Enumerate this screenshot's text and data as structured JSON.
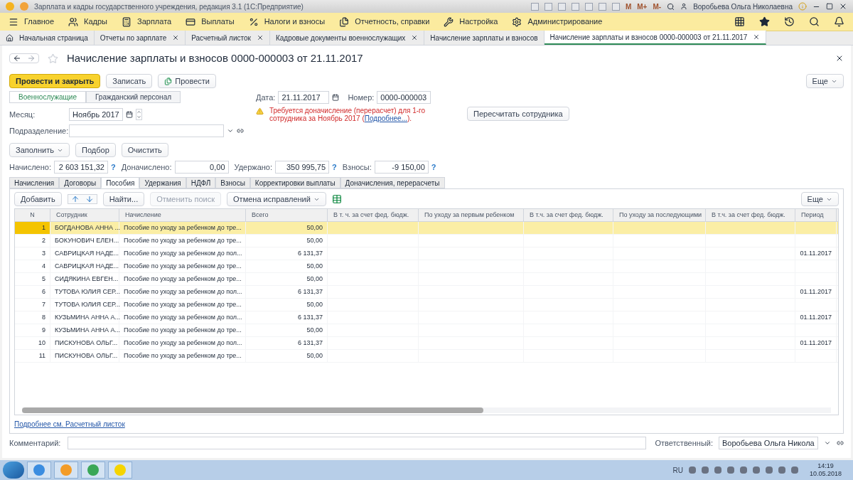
{
  "window": {
    "title": "Зарплата и кадры государственного учреждения, редакция 3.1  (1С:Предприятие)",
    "user": "Воробьева Ольга Николаевна",
    "memory_buttons": [
      "M",
      "M+",
      "M-"
    ]
  },
  "menu": [
    {
      "label": "Главное"
    },
    {
      "label": "Кадры"
    },
    {
      "label": "Зарплата"
    },
    {
      "label": "Выплаты"
    },
    {
      "label": "Налоги и взносы"
    },
    {
      "label": "Отчетность, справки"
    },
    {
      "label": "Настройка"
    },
    {
      "label": "Администрирование"
    }
  ],
  "open_tabs": [
    {
      "label": "Начальная страница",
      "home": true,
      "closable": false,
      "selected": false
    },
    {
      "label": "Отчеты по зарплате",
      "home": false,
      "closable": true,
      "selected": false
    },
    {
      "label": "Расчетный листок",
      "home": false,
      "closable": true,
      "selected": false
    },
    {
      "label": "Кадровые документы военнослужащих",
      "home": false,
      "closable": true,
      "selected": false
    },
    {
      "label": "Начисление зарплаты и взносов",
      "home": false,
      "closable": false,
      "selected": false
    },
    {
      "label": "Начисление зарплаты и взносов 0000-000003 от 21.11.2017",
      "home": false,
      "closable": true,
      "selected": true
    }
  ],
  "document": {
    "title": "Начисление зарплаты и взносов 0000-000003 от 21.11.2017",
    "buttons": [
      {
        "label": "Провести и закрыть",
        "kind": "primary"
      },
      {
        "label": "Записать",
        "kind": "plain"
      },
      {
        "label": "Провести",
        "kind": "icon"
      }
    ],
    "more": "Еще",
    "segments": [
      {
        "label": "Военнослужащие",
        "selected": true
      },
      {
        "label": "Гражданский персонал",
        "selected": false
      }
    ],
    "date_label": "Дата:",
    "date": "21.11.2017",
    "number_label": "Номер:",
    "number": "0000-000003",
    "month_label": "Месяц:",
    "month": "Ноябрь 2017",
    "warning": "Требуется доначисление (перерасчет) для 1-го сотрудника за Ноябрь 2017 (",
    "warning_link": "Подробнее...",
    "warning_end": ").",
    "recalc_button": "Пересчитать сотрудника",
    "department_label": "Подразделение:",
    "fill_buttons": [
      {
        "label": "Заполнить",
        "dropdown": true
      },
      {
        "label": "Подбор",
        "dropdown": false
      },
      {
        "label": "Очистить",
        "dropdown": false
      }
    ],
    "totals": [
      {
        "label": "Начислено:",
        "value": "2 603 151,32",
        "help": "?"
      },
      {
        "label": "Доначислено:",
        "value": "0,00"
      },
      {
        "label": "Удержано:",
        "value": "350 995,75",
        "help": "?"
      },
      {
        "label": "Взносы:",
        "value": "-9 150,00",
        "help": "?"
      }
    ],
    "comment_label": "Комментарий:",
    "responsible_label": "Ответственный:",
    "responsible": "Воробьева Ольга Никола",
    "footer_link": "Подробнее см. Расчетный листок"
  },
  "section_tabs": [
    {
      "label": "Начисления",
      "selected": false
    },
    {
      "label": "Договоры",
      "selected": false
    },
    {
      "label": "Пособия",
      "selected": true
    },
    {
      "label": "Удержания",
      "selected": false
    },
    {
      "label": "НДФЛ",
      "selected": false
    },
    {
      "label": "Взносы",
      "selected": false
    },
    {
      "label": "Корректировки выплаты",
      "selected": false
    },
    {
      "label": "Доначисления, перерасчеты",
      "selected": false
    }
  ],
  "table_toolbar": [
    {
      "label": "Добавить",
      "kind": "button",
      "disabled": false
    },
    {
      "kind": "arrows",
      "disabled": false
    },
    {
      "label": "Найти...",
      "kind": "button",
      "disabled": false
    },
    {
      "label": "Отменить поиск",
      "kind": "button",
      "disabled": true
    },
    {
      "label": "Отмена исправлений",
      "kind": "dropdown",
      "disabled": false
    },
    {
      "kind": "table-icon",
      "disabled": false
    }
  ],
  "table_more": "Еще",
  "table": {
    "columns": [
      "N",
      "Сотрудник",
      "Начисление",
      "Всего",
      "В т. ч. за счет фед. бюдж.",
      "По уходу за первым ребенком",
      "В т.ч. за счет фед. бюдж.",
      "По уходу за последующими",
      "В т.ч. за счет фед. бюдж.",
      "Период"
    ],
    "rows": [
      {
        "n": "1",
        "employee": "БОГДАНОВА АННА ...",
        "accrual": "Пособие по уходу за ребенком до тре...",
        "total": "50,00",
        "period": "",
        "selected": true
      },
      {
        "n": "2",
        "employee": "БОКУНОВИЧ ЕЛЕН...",
        "accrual": "Пособие по уходу за ребенком до тре...",
        "total": "50,00",
        "period": "",
        "selected": false
      },
      {
        "n": "3",
        "employee": "САВРИЦКАЯ НАДЕ...",
        "accrual": "Пособие по уходу за ребенком до пол...",
        "total": "6 131,37",
        "period": "01.11.2017",
        "selected": false
      },
      {
        "n": "4",
        "employee": "САВРИЦКАЯ НАДЕ...",
        "accrual": "Пособие по уходу за ребенком до тре...",
        "total": "50,00",
        "period": "",
        "selected": false
      },
      {
        "n": "5",
        "employee": "СИДЯКИНА ЕВГЕН...",
        "accrual": "Пособие по уходу за ребенком до тре...",
        "total": "50,00",
        "period": "",
        "selected": false
      },
      {
        "n": "6",
        "employee": "ТУТОВА ЮЛИЯ СЕР...",
        "accrual": "Пособие по уходу за ребенком до пол...",
        "total": "6 131,37",
        "period": "01.11.2017",
        "selected": false
      },
      {
        "n": "7",
        "employee": "ТУТОВА ЮЛИЯ СЕР...",
        "accrual": "Пособие по уходу за ребенком до тре...",
        "total": "50,00",
        "period": "",
        "selected": false
      },
      {
        "n": "8",
        "employee": "КУЗЬМИНА АННА А...",
        "accrual": "Пособие по уходу за ребенком до пол...",
        "total": "6 131,37",
        "period": "01.11.2017",
        "selected": false
      },
      {
        "n": "9",
        "employee": "КУЗЬМИНА АННА А...",
        "accrual": "Пособие по уходу за ребенком до тре...",
        "total": "50,00",
        "period": "",
        "selected": false
      },
      {
        "n": "10",
        "employee": "ПИСКУНОВА ОЛЬГ...",
        "accrual": "Пособие по уходу за ребенком до пол...",
        "total": "6 131,37",
        "period": "01.11.2017",
        "selected": false
      },
      {
        "n": "11",
        "employee": "ПИСКУНОВА ОЛЬГ...",
        "accrual": "Пособие по уходу за ребенком до тре...",
        "total": "50,00",
        "period": "",
        "selected": false
      }
    ]
  },
  "taskbar": {
    "language": "RU",
    "time": "14:19",
    "date": "10.05.2018"
  }
}
